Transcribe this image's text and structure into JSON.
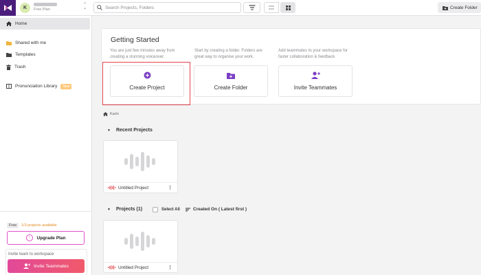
{
  "header": {
    "workspace": {
      "initial": "K",
      "plan": "Free Plan"
    },
    "search_placeholder": "Search Projects, Folders",
    "create_folder_label": "Create Folder"
  },
  "sidebar": {
    "items": [
      {
        "label": "Home",
        "icon": "home-icon"
      },
      {
        "label": "Shared with me",
        "icon": "shared-folder-icon"
      },
      {
        "label": "Templates",
        "icon": "folder-icon"
      },
      {
        "label": "Trash",
        "icon": "trash-icon"
      },
      {
        "label": "Pronunciation Library",
        "icon": "book-icon",
        "badge": "New"
      }
    ],
    "plan_tag": "Free",
    "projects_available": "1/3 projects available",
    "upgrade_label": "Upgrade Plan",
    "invite_label": "Invite team to workspace",
    "invite_button": "Invite Teammates"
  },
  "getting_started": {
    "title": "Getting Started",
    "steps": [
      {
        "desc": "You are just few minutes away from creating a stunning voiceover.",
        "card_label": "Create Project",
        "icon": "plus-circle-icon"
      },
      {
        "desc": "Start by creating a folder. Folders are great way to organise your work.",
        "card_label": "Create Folder",
        "icon": "folder-plus-icon"
      },
      {
        "desc": "Add teammates to your workspace for faster collaboration & feedback",
        "card_label": "Invite Teammates",
        "icon": "user-plus-icon"
      }
    ]
  },
  "breadcrumb": "Karin",
  "recent": {
    "title": "Recent Projects",
    "projects": [
      {
        "name": "Untitled Project"
      }
    ]
  },
  "projects": {
    "title": "Projects (1)",
    "select_all": "Select All",
    "sort_label": "Created On ( Latest first )",
    "items": [
      {
        "name": "Untitled Project"
      }
    ]
  },
  "colors": {
    "brand": "#4a1d7c",
    "accent": "#7b3fc4",
    "highlight": "#e0454d",
    "invite_gradient": "#e2499a"
  }
}
